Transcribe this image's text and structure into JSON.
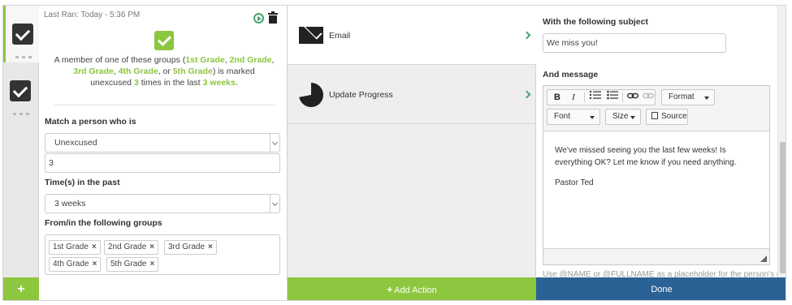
{
  "trigger": {
    "last_ran": "Last Ran: Today - 5:36 PM",
    "summary": {
      "p1": "A member of one of these groups (",
      "g1": "1st Grade",
      "c1": ", ",
      "g2": "2nd Grade",
      "c2": ", ",
      "g3": "3rd Grade",
      "c3": ", ",
      "g4": "4th Grade",
      "c4": ", or ",
      "g5": "5th Grade",
      "p2": ") is marked unexcused ",
      "count": "3",
      "p3": " times in the last ",
      "period": "3 weeks",
      "p4": "."
    },
    "match_label": "Match a person who is",
    "match_value": "Unexcused",
    "count_value": "3",
    "times_label": "Time(s) in the past",
    "times_value": "3 weeks",
    "groups_label": "From/in the following groups",
    "groups": [
      "1st Grade",
      "2nd Grade",
      "3rd Grade",
      "4th Grade",
      "5th Grade"
    ],
    "tag_remove": "×"
  },
  "rail": {
    "add_label": "+"
  },
  "actions": {
    "items": [
      {
        "label": "Email",
        "icon": "envelope-icon"
      },
      {
        "label": "Update Progress",
        "icon": "pie-chart-icon"
      }
    ],
    "add_label": "Add Action",
    "add_plus": "+"
  },
  "editor": {
    "subject_label": "With the following subject",
    "subject_value": "We miss you!",
    "message_label": "And message",
    "toolbar": {
      "bold": "B",
      "italic": "I",
      "format": "Format",
      "font": "Font",
      "size": "Size",
      "source": "Source"
    },
    "body": [
      "We've missed seeing you the last few weeks! Is everything OK? Let me know if you need anything.",
      "Pastor Ted"
    ],
    "hint": "Use @NAME or @FULLNAME as a placeholder for the person's name",
    "done_label": "Done"
  },
  "colors": {
    "accent_green": "#8dc63f",
    "done_blue": "#2b6296",
    "icon_green": "#4aa36f"
  }
}
